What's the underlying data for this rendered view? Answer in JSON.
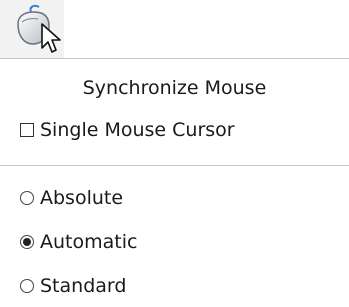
{
  "toolbar": {
    "mouse_button_icon": "mouse-icon"
  },
  "menu": {
    "header": "Synchronize Mouse",
    "single_cursor": {
      "label": "Single Mouse Cursor",
      "checked": false
    },
    "modes": [
      {
        "label": "Absolute",
        "selected": false
      },
      {
        "label": "Automatic",
        "selected": true
      },
      {
        "label": "Standard",
        "selected": false
      }
    ]
  }
}
